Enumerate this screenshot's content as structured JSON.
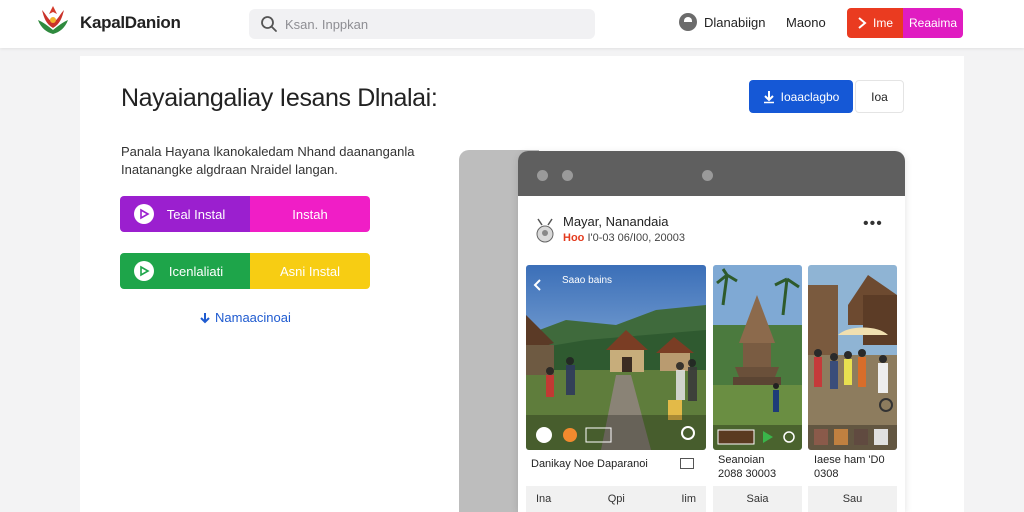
{
  "header": {
    "brand": "KapalDanion",
    "search_placeholder": "Ksan. Inppkan",
    "dashboard_label": "Dlanabiign",
    "menu_label": "Maono",
    "cta_red_label": "Ime",
    "cta_pink_label": "Reaaima"
  },
  "main": {
    "title": "Nayaiangaliay Iesans Dlnalai:",
    "download_label": "Ioaaclagbo",
    "ios_label": "Ioa",
    "description": "Panala Hayana lkanokaledam Nhand daananganla Inatanangke algdraan Nraidel langan.",
    "buttons": {
      "teal_install": "Teal Instal",
      "instah": "Instah",
      "icenlaliati": "Icenlaliati",
      "asni_instal": "Asni Instal"
    },
    "more_link": "Namaacinoai"
  },
  "post": {
    "author": "Mayar, Nanandaia",
    "meta_tag": "Hoo",
    "meta_date": "I'0-03 06/I00, 20003",
    "photo1_label": "Saao bains",
    "caption1": "Danikay Noe Daparanoi",
    "caption2_line1": "Seanoian",
    "caption2_line2": "2088 30003",
    "caption3_line1": "Iaese ham 'D0",
    "caption3_line2": "0308",
    "footer": {
      "c1a": "Ina",
      "c1b": "Qpi",
      "c1c": "Iim",
      "c2": "Saia",
      "c3": "Sau"
    }
  },
  "colors": {
    "primary_blue": "#1558d6",
    "red": "#ea3b20",
    "pink": "#e01cc1",
    "purple": "#9b1fcf",
    "green": "#1ea54a",
    "yellow": "#f7cd13"
  }
}
